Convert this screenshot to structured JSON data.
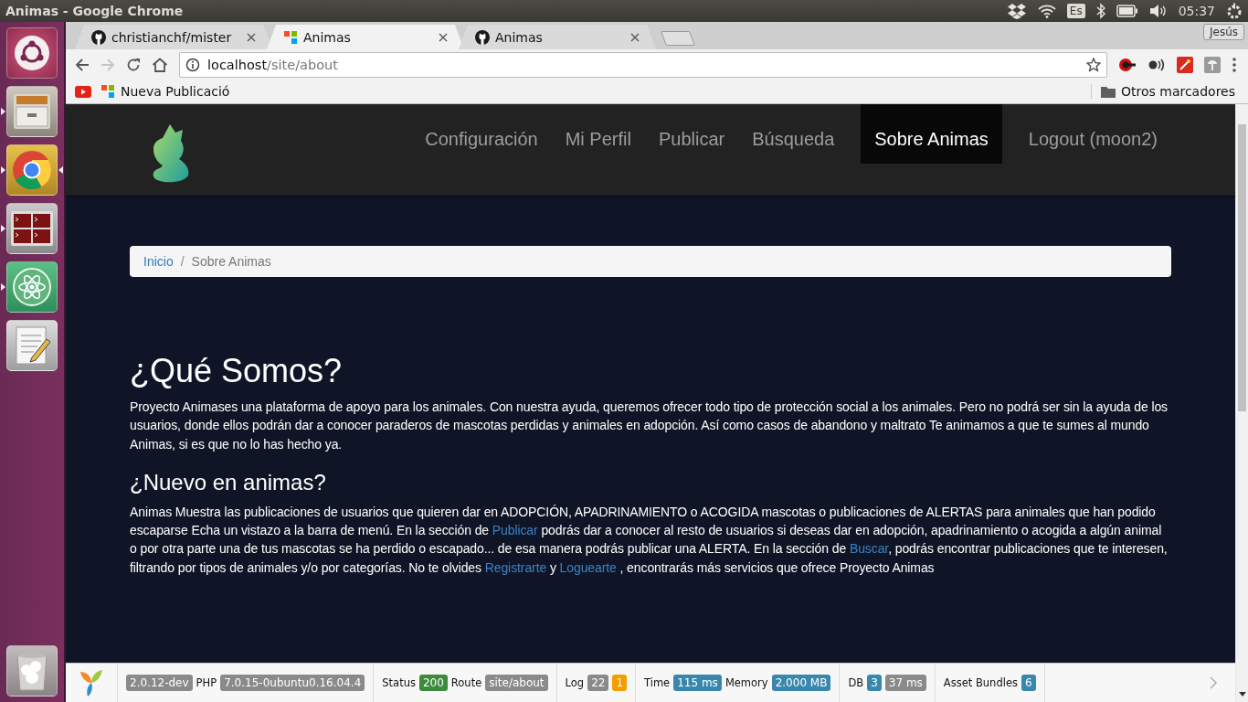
{
  "os_panel": {
    "title": "Animas - Google Chrome",
    "keyboard_layout": "Es",
    "time": "05:37"
  },
  "launcher": [
    {
      "kind": "dash",
      "running": false,
      "focused": false
    },
    {
      "kind": "files",
      "running": true,
      "focused": false
    },
    {
      "kind": "browser",
      "running": true,
      "focused": true
    },
    {
      "kind": "terminal",
      "running": true,
      "focused": false
    },
    {
      "kind": "atom",
      "running": true,
      "focused": false
    },
    {
      "kind": "editor",
      "running": false,
      "focused": false
    },
    {
      "kind": "trash",
      "running": false,
      "focused": false
    }
  ],
  "browser": {
    "tabs": [
      {
        "kind": "github",
        "label": "christianchf/mister",
        "selected": false
      },
      {
        "kind": "animas",
        "label": "Animas",
        "selected": true
      },
      {
        "kind": "github",
        "label": "Animas",
        "selected": false
      }
    ],
    "profile": "Jesús",
    "address": {
      "host": "localhost",
      "path": "/site/about"
    },
    "bookmarks": [
      {
        "kind": "youtube"
      },
      {
        "kind": "animas",
        "label": "Nueva Publicació"
      }
    ],
    "other_bookmarks": "Otros marcadores"
  },
  "site": {
    "nav": [
      {
        "label": "Configuración",
        "selected": false
      },
      {
        "label": "Mi Perfil",
        "selected": false
      },
      {
        "label": "Publicar",
        "selected": false
      },
      {
        "label": "Búsqueda",
        "selected": false
      },
      {
        "label": "Sobre Animas",
        "selected": true
      },
      {
        "label": "Logout (moon2)",
        "selected": false
      }
    ],
    "breadcrumb": {
      "separator": "/",
      "items": [
        {
          "kind": "link",
          "label": "Inicio"
        },
        {
          "kind": "current",
          "label": "Sobre Animas"
        }
      ]
    },
    "sections": [
      {
        "kind": "title",
        "heading": "¿Qué Somos?",
        "paragraph": [
          {
            "kind": "text",
            "text": "Proyecto Animases una plataforma de apoyo para los animales. Con nuestra ayuda, queremos ofrecer todo tipo de protección social a los animales. Pero no podrá ser sin la ayuda de los usuarios, donde ellos podrán dar a conocer paraderos de mascotas perdidas y animales en adopción. Así como casos de abandono y maltrato Te animamos a que te sumes al mundo Animas, si es que no lo has hecho ya."
          }
        ]
      },
      {
        "kind": "subtitle",
        "heading": "¿Nuevo en animas?",
        "paragraph": [
          {
            "kind": "text",
            "text": "Animas Muestra las publicaciones de usuarios que quieren dar en ADOPCIÓN, APADRINAMIENTO o ACOGIDA mascotas o publicaciones de ALERTAS para animales que han podido escaparse Echa un vistazo a la barra de menú. En la sección de "
          },
          {
            "kind": "link",
            "text": "Publicar"
          },
          {
            "kind": "text",
            "text": " podrás dar a conocer al resto de usuarios si deseas dar en adopción, apadrinamiento o acogida a algún animal o por otra parte una de tus mascotas se ha perdido o escapado... de esa manera podrás publicar una ALERTA. En la sección de "
          },
          {
            "kind": "link",
            "text": "Buscar"
          },
          {
            "kind": "text",
            "text": ", podrás encontrar publicaciones que te interesen, filtrando por tipos de animales y/o por categorías. No te olvides "
          },
          {
            "kind": "link",
            "text": "Registrarte"
          },
          {
            "kind": "text",
            "text": " y "
          },
          {
            "kind": "link",
            "text": "Loguearte"
          },
          {
            "kind": "text",
            "text": " , encontrarás más servicios que ofrece Proyecto Animas"
          }
        ]
      }
    ]
  },
  "debug_toolbar": {
    "groups": [
      [
        {
          "kind": "badge",
          "text": "2.0.12-dev",
          "color": "#8a8a8a"
        },
        {
          "kind": "label",
          "text": "PHP"
        },
        {
          "kind": "badge",
          "text": "7.0.15-0ubuntu0.16.04.4",
          "color": "#8a8a8a"
        }
      ],
      [
        {
          "kind": "label",
          "text": "Status"
        },
        {
          "kind": "badge",
          "text": "200",
          "color": "#3c8a3c"
        },
        {
          "kind": "label",
          "text": "Route"
        },
        {
          "kind": "badge",
          "text": "site/about",
          "color": "#8a8a8a"
        }
      ],
      [
        {
          "kind": "label",
          "text": "Log"
        },
        {
          "kind": "badge",
          "text": "22",
          "color": "#8a8a8a"
        },
        {
          "kind": "badge",
          "text": "1",
          "color": "#f59c00"
        }
      ],
      [
        {
          "kind": "label",
          "text": "Time"
        },
        {
          "kind": "badge",
          "text": "115 ms",
          "color": "#3a87ad"
        },
        {
          "kind": "label",
          "text": "Memory"
        },
        {
          "kind": "badge",
          "text": "2.000 MB",
          "color": "#3a87ad"
        }
      ],
      [
        {
          "kind": "label",
          "text": "DB"
        },
        {
          "kind": "badge",
          "text": "3",
          "color": "#3a87ad"
        },
        {
          "kind": "badge",
          "text": "37 ms",
          "color": "#8a8a8a"
        }
      ],
      [
        {
          "kind": "label",
          "text": "Asset Bundles"
        },
        {
          "kind": "badge",
          "text": "6",
          "color": "#3a87ad"
        }
      ]
    ]
  }
}
